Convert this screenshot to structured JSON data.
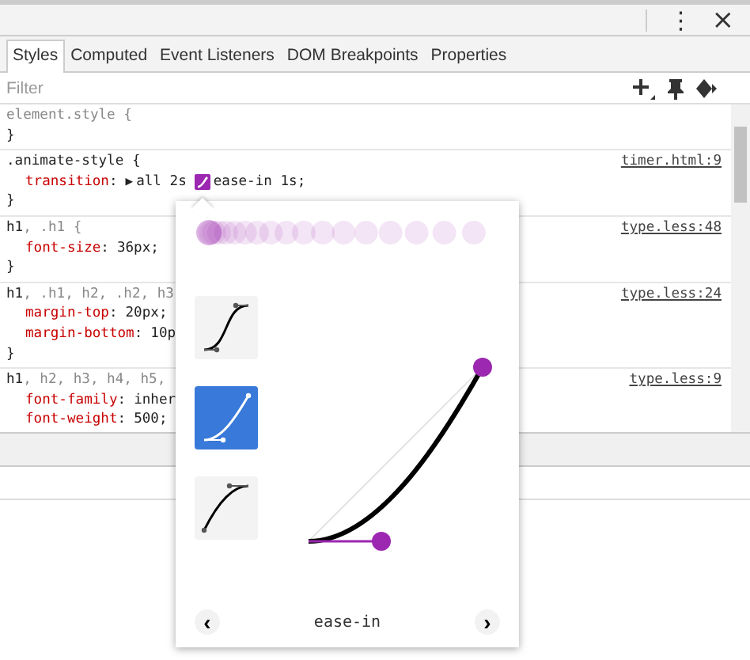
{
  "toolbar": {
    "more_button": "⋮",
    "close_button": "×"
  },
  "tabs": [
    {
      "label": "Styles",
      "selected": true
    },
    {
      "label": "Computed",
      "selected": false
    },
    {
      "label": "Event Listeners",
      "selected": false
    },
    {
      "label": "DOM Breakpoints",
      "selected": false
    },
    {
      "label": "Properties",
      "selected": false
    }
  ],
  "filter": {
    "placeholder": "Filter"
  },
  "rules": [
    {
      "selector": [
        {
          "text": "element.style {",
          "matched": false
        }
      ],
      "close": "}"
    },
    {
      "selector": [
        {
          "text": ".animate-style {",
          "matched": true
        }
      ],
      "source": "timer.html:9",
      "properties": [
        {
          "kind": "transition",
          "name": "transition",
          "colon": ":",
          "expander": "▶",
          "value": "all 2s",
          "value_after": "ease-in 1s;"
        }
      ],
      "close": "}"
    },
    {
      "selector": [
        {
          "text": "h1",
          "matched": true
        },
        {
          "text": ", .h1 {",
          "matched": false
        }
      ],
      "source": "type.less:48",
      "properties": [
        {
          "kind": "plain",
          "name": "font-size",
          "colon": ":",
          "value": "36px;"
        }
      ],
      "close": "}"
    },
    {
      "selector": [
        {
          "text": "h1",
          "matched": true
        },
        {
          "text": ", .h1, h2, .h2, h3",
          "matched": false
        }
      ],
      "source": "type.less:24",
      "properties": [
        {
          "kind": "plain",
          "name": "margin-top",
          "colon": ":",
          "value": "20px;"
        },
        {
          "kind": "plain",
          "name": "margin-bottom",
          "colon": ":",
          "value": "10p"
        }
      ],
      "close": "}"
    },
    {
      "selector": [
        {
          "text": "h1",
          "matched": true
        },
        {
          "text": ", h2, h3, h4, h5,",
          "matched": false
        }
      ],
      "source": "type.less:9",
      "properties": [
        {
          "kind": "plain",
          "name": "font-family",
          "colon": ":",
          "value": "inher"
        },
        {
          "kind": "plain",
          "name": "font-weight",
          "colon": ":",
          "value": "500;"
        }
      ]
    }
  ],
  "bezier_editor": {
    "presets": [
      {
        "kind": "ease-in-out",
        "selected": false
      },
      {
        "kind": "ease-in",
        "selected": true
      },
      {
        "kind": "ease-out",
        "selected": false
      }
    ],
    "prev_button": "‹",
    "next_button": "›",
    "preset_name": "ease-in"
  }
}
